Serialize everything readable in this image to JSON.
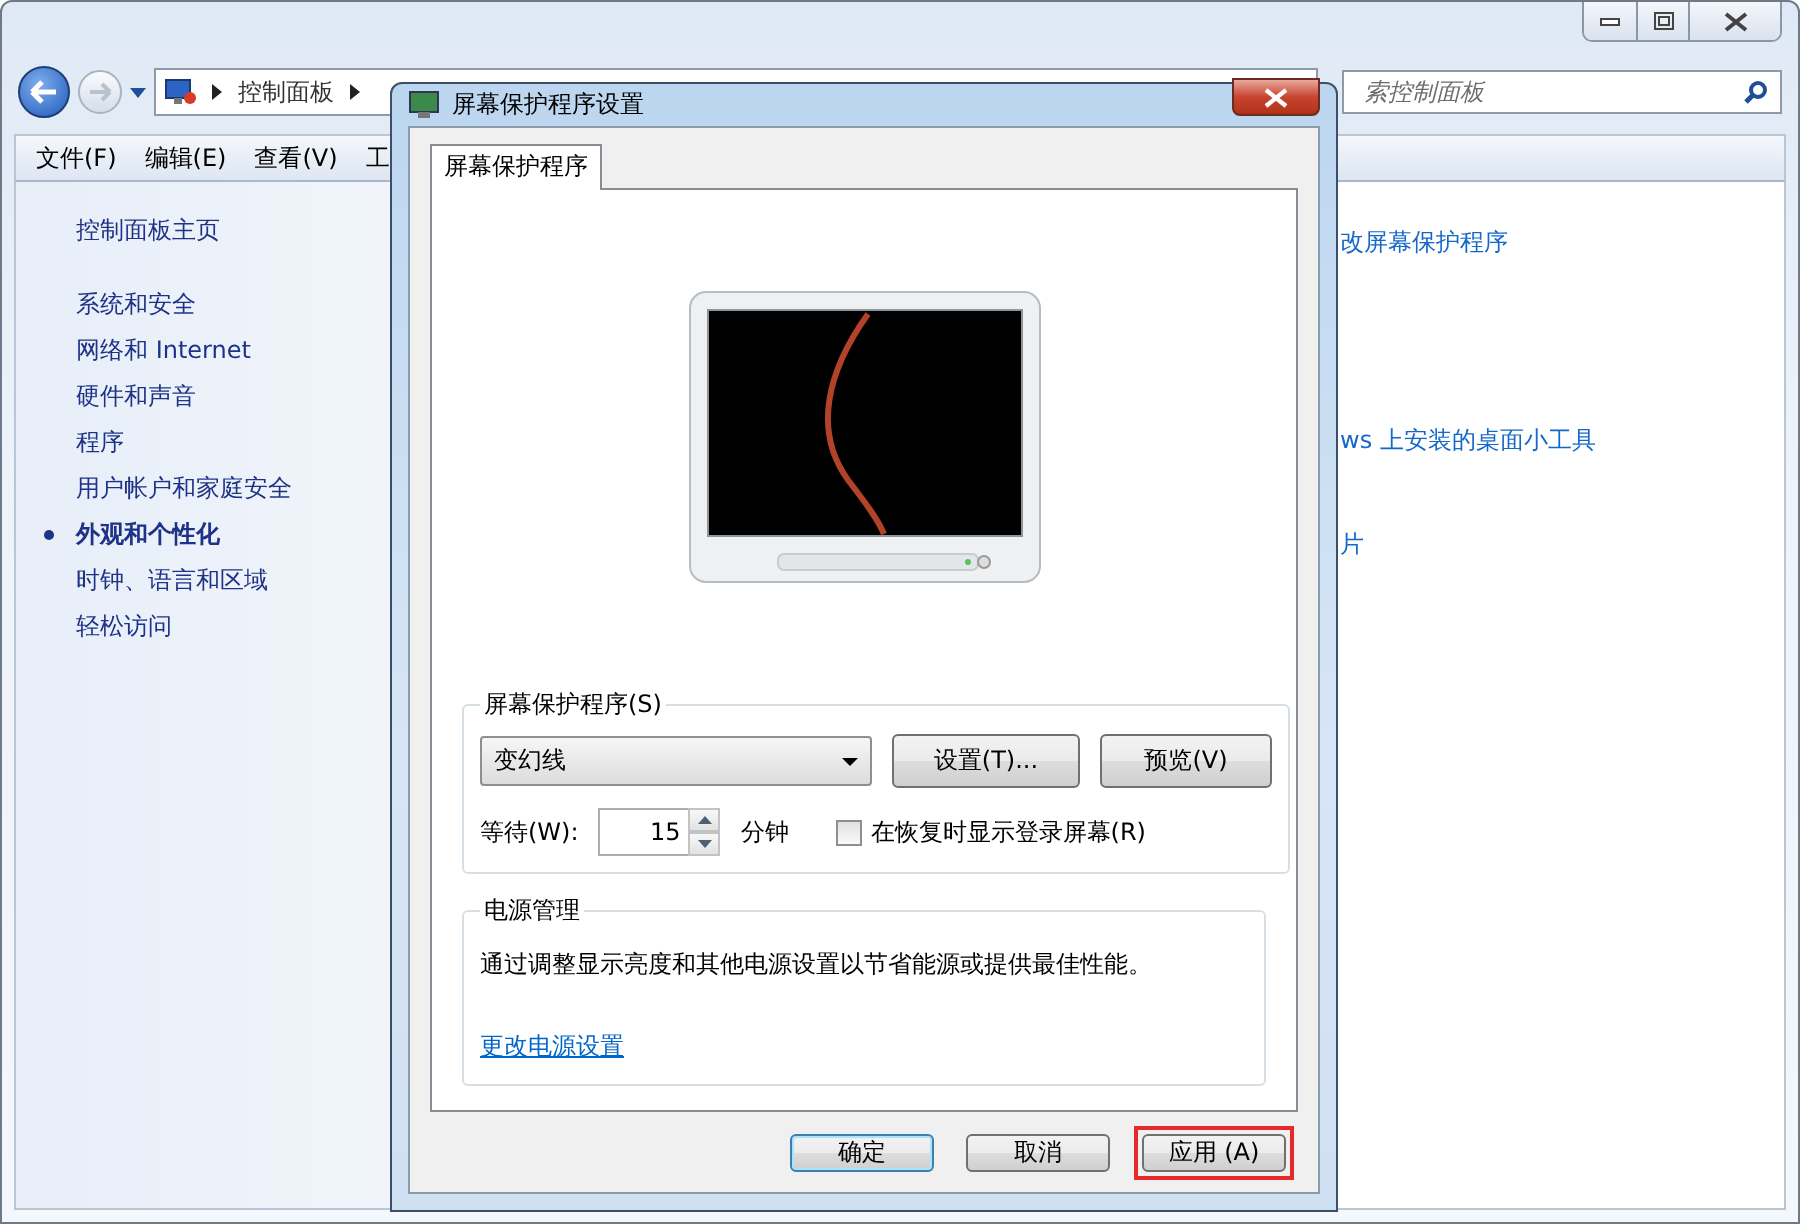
{
  "explorer": {
    "address": {
      "crumbs": [
        "控制面板"
      ]
    },
    "search": {
      "placeholder": "索控制面板"
    },
    "menu": [
      "文件(F)",
      "编辑(E)",
      "查看(V)",
      "工"
    ],
    "sidebar": {
      "home": "控制面板主页",
      "items": [
        {
          "label": "系统和安全",
          "selected": false
        },
        {
          "label": "网络和 Internet",
          "selected": false
        },
        {
          "label": "硬件和声音",
          "selected": false
        },
        {
          "label": "程序",
          "selected": false
        },
        {
          "label": "用户帐户和家庭安全",
          "selected": false
        },
        {
          "label": "外观和个性化",
          "selected": true
        },
        {
          "label": "时钟、语言和区域",
          "selected": false
        },
        {
          "label": "轻松访问",
          "selected": false
        }
      ]
    },
    "links": [
      "改屏幕保护程序",
      "ws 上安装的桌面小工具",
      "片"
    ]
  },
  "dialog": {
    "title": "屏幕保护程序设置",
    "tabs": [
      {
        "label": "屏幕保护程序",
        "selected": true
      }
    ],
    "screensaver": {
      "legend": "屏幕保护程序(S)",
      "value": "变幻线",
      "buttons": [
        "设置(T)...",
        "预览(V)"
      ],
      "wait_label": "等待(W):",
      "wait_value": "15",
      "unit": "分钟",
      "resume_checkbox": {
        "label": "在恢复时显示登录屏幕(R)",
        "checked": false
      }
    },
    "power": {
      "legend": "电源管理",
      "text": "通过调整显示亮度和其他电源设置以节省能源或提供最佳性能。",
      "link": "更改电源设置"
    },
    "buttons": [
      {
        "label": "确定",
        "default": true,
        "highlighted": false
      },
      {
        "label": "取消",
        "default": false,
        "highlighted": false
      },
      {
        "label": "应用 (A)",
        "default": false,
        "highlighted": true
      }
    ]
  }
}
